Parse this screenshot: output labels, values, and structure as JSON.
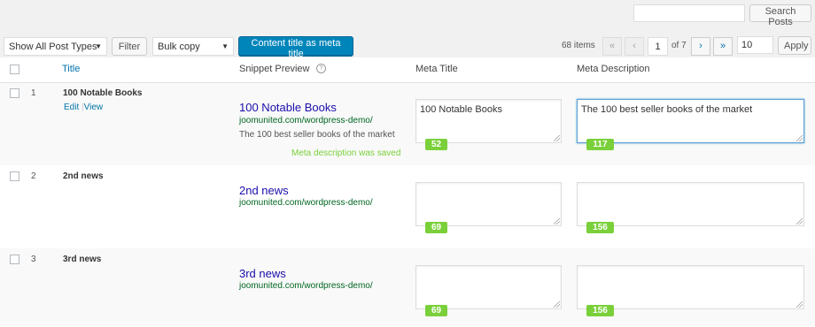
{
  "search": {
    "placeholder": "",
    "value": "",
    "button": "Search Posts"
  },
  "toolbar": {
    "post_type_select": "Show All Post Types",
    "filter_button": "Filter",
    "bulk_select": "Bulk copy",
    "primary_button": "Content title as meta title",
    "items_count": "68 items",
    "first_page": "«",
    "prev_page": "‹",
    "current_page": "1",
    "of_pages": "of 7",
    "next_page": "›",
    "last_page": "»",
    "per_page": "10",
    "apply_button": "Apply"
  },
  "columns": {
    "title": "Title",
    "snippet": "Snippet Preview",
    "help": "?",
    "meta_title": "Meta Title",
    "meta_description": "Meta Description"
  },
  "rows": [
    {
      "num": "1",
      "title": "100 Notable Books",
      "edit": "Edit",
      "view": "View",
      "snippet_title": "100 Notable Books",
      "snippet_url": "joomunited.com/wordpress-demo/",
      "snippet_desc": "The 100 best seller books of the market",
      "saved": "Meta description was saved",
      "meta_title": "100 Notable Books",
      "meta_title_count": "52",
      "meta_description": "The 100 best seller books of the market",
      "meta_description_count": "117"
    },
    {
      "num": "2",
      "title": "2nd news",
      "snippet_title": "2nd news",
      "snippet_url": "joomunited.com/wordpress-demo/",
      "meta_title": "",
      "meta_title_count": "69",
      "meta_description": "",
      "meta_description_count": "156"
    },
    {
      "num": "3",
      "title": "3rd news",
      "snippet_title": "3rd news",
      "snippet_url": "joomunited.com/wordpress-demo/",
      "meta_title": "",
      "meta_title_count": "69",
      "meta_description": "",
      "meta_description_count": "156"
    }
  ],
  "colors": {
    "accent": "#0085ba",
    "badge": "#7ad03a",
    "link": "#0073aa",
    "snippet_title": "#1a0dab",
    "snippet_url": "#006621"
  }
}
